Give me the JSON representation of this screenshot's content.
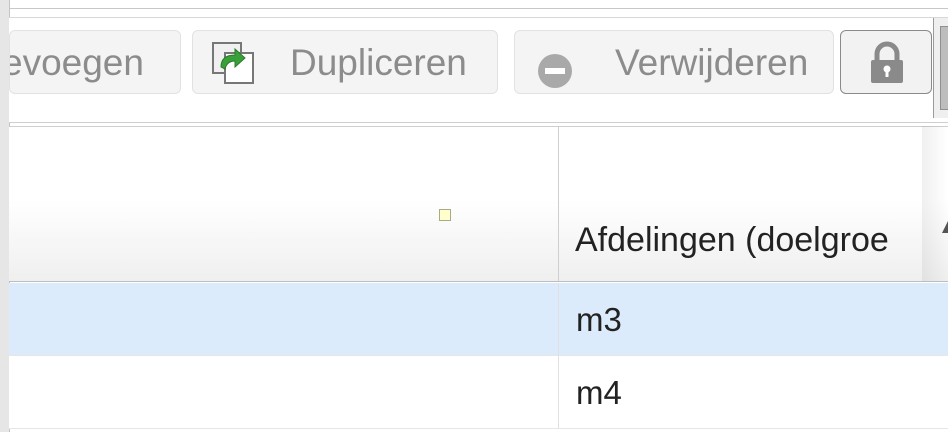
{
  "toolbar": {
    "add_label": "evoegen",
    "duplicate_label": "Dupliceren",
    "delete_label": "Verwijderen",
    "lock_icon": "lock-icon"
  },
  "grid": {
    "columns": [
      {
        "header": ""
      },
      {
        "header": "Afdelingen (doelgroe"
      }
    ],
    "rows": [
      {
        "cells": [
          "",
          "m3"
        ],
        "selected": true
      },
      {
        "cells": [
          "",
          "m4"
        ],
        "selected": false
      }
    ]
  },
  "colors": {
    "selected_row": "#dcebfb",
    "button_text": "#8c8c8c",
    "duplicate_icon": "#3aa03a"
  }
}
